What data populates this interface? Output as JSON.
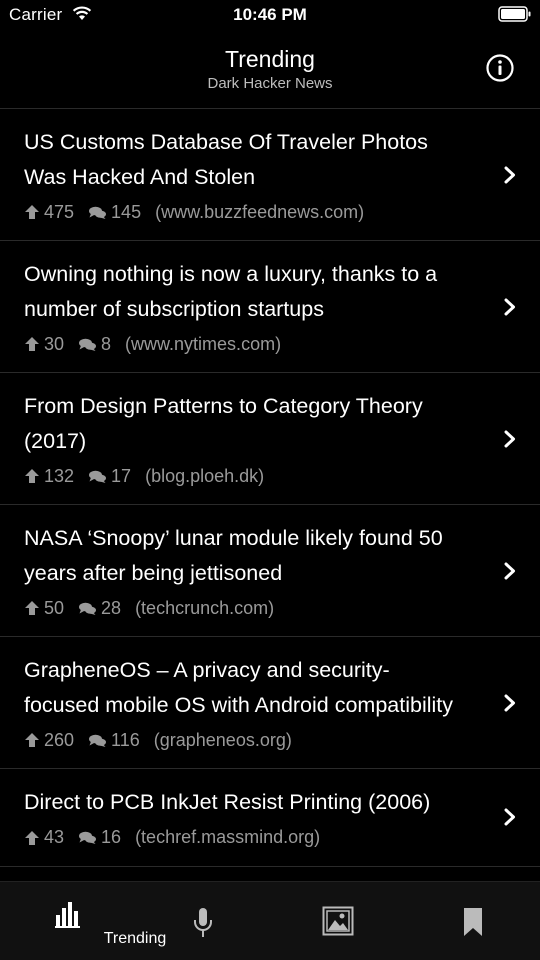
{
  "status": {
    "carrier": "Carrier",
    "time": "10:46 PM"
  },
  "nav": {
    "title": "Trending",
    "subtitle": "Dark Hacker News"
  },
  "stories": [
    {
      "title": "US Customs Database Of Traveler Photos Was Hacked And Stolen",
      "points": "475",
      "comments": "145",
      "domain": "(www.buzzfeednews.com)"
    },
    {
      "title": "Owning nothing is now a luxury, thanks to a number of subscription startups",
      "points": "30",
      "comments": "8",
      "domain": "(www.nytimes.com)"
    },
    {
      "title": "From Design Patterns to Category Theory (2017)",
      "points": "132",
      "comments": "17",
      "domain": "(blog.ploeh.dk)"
    },
    {
      "title": "NASA ‘Snoopy’ lunar module likely found 50 years after being jettisoned",
      "points": "50",
      "comments": "28",
      "domain": "(techcrunch.com)"
    },
    {
      "title": "GrapheneOS – A privacy and security-focused mobile OS with Android compatibility",
      "points": "260",
      "comments": "116",
      "domain": "(grapheneos.org)"
    },
    {
      "title": "Direct to PCB InkJet Resist Printing (2006)",
      "points": "43",
      "comments": "16",
      "domain": "(techref.massmind.org)"
    }
  ],
  "tabbar": {
    "tabs": [
      {
        "label": "Trending",
        "icon": "bar-chart-icon",
        "selected": true
      },
      {
        "label": "",
        "icon": "microphone-icon"
      },
      {
        "label": "",
        "icon": "image-icon"
      },
      {
        "label": "",
        "icon": "bookmark-icon"
      }
    ]
  },
  "colors": {
    "background": "#000000",
    "secondary_text": "#9a9a9a",
    "separator": "#2a2a2a"
  }
}
